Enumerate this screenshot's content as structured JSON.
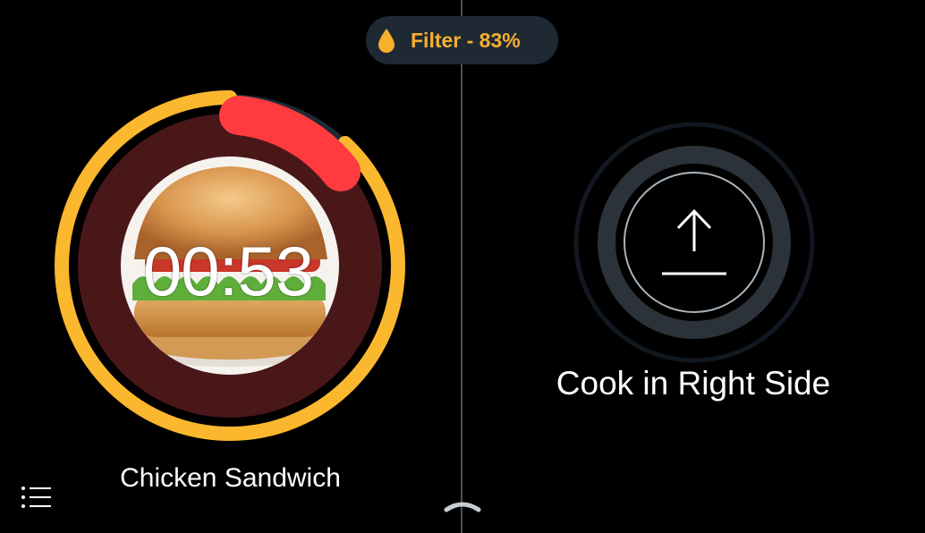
{
  "filter": {
    "label": "Filter - 83%",
    "level_percent": 83,
    "icon": "oil-drop-icon",
    "accent_color": "#f5b02e"
  },
  "left_panel": {
    "timer": "00:53",
    "item_name": "Chicken Sandwich",
    "timer_progress_fraction": 0.88,
    "ring_color": "#fbb82e",
    "alert_color": "#ff3b3f",
    "menu_icon": "list-icon"
  },
  "right_panel": {
    "action_label": "Cook in Right Side",
    "action_icon": "upload-icon"
  },
  "bottom": {
    "handle_icon": "chevron-up-icon"
  }
}
